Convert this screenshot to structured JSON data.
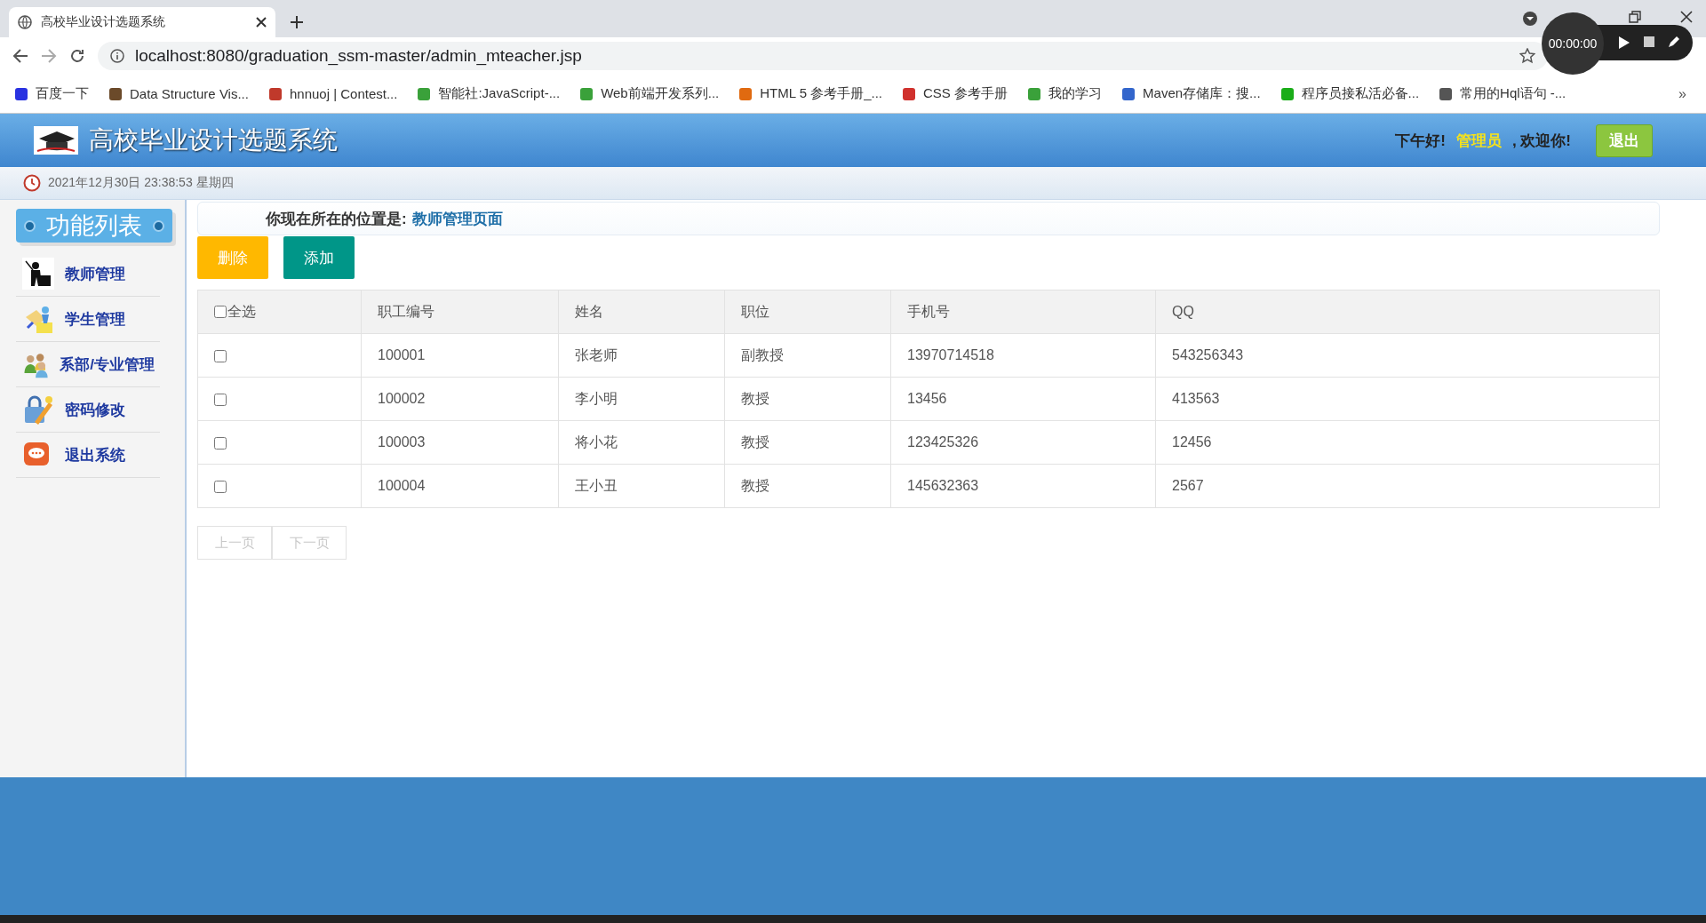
{
  "browser": {
    "tab_title": "高校毕业设计选题系统",
    "url": "localhost:8080/graduation_ssm-master/admin_mteacher.jsp",
    "more": "»",
    "bookmarks": [
      {
        "label": "百度一下",
        "color": "#2932e1"
      },
      {
        "label": "Data Structure Vis...",
        "color": "#6b4a2a"
      },
      {
        "label": "hnnuoj | Contest...",
        "color": "#c0392b"
      },
      {
        "label": "智能社:JavaScript-...",
        "color": "#3aa13a"
      },
      {
        "label": "Web前端开发系列...",
        "color": "#3aa13a"
      },
      {
        "label": "HTML 5 参考手册_...",
        "color": "#e06a10"
      },
      {
        "label": "CSS 参考手册",
        "color": "#d0312d"
      },
      {
        "label": "我的学习",
        "color": "#3aa13a"
      },
      {
        "label": "Maven存储库：搜...",
        "color": "#3366cc"
      },
      {
        "label": "程序员接私活必备...",
        "color": "#1aad19"
      },
      {
        "label": "常用的Hql语句 -...",
        "color": "#555555"
      }
    ]
  },
  "recorder": {
    "time": "00:00:00"
  },
  "header": {
    "title": "高校毕业设计选题系统",
    "greeting": "下午好!",
    "user": "管理员",
    "welcome": ", 欢迎你!",
    "logout": "退出"
  },
  "datetime": "2021年12月30日 23:38:53 星期四",
  "sidebar": {
    "title": "功能列表",
    "items": [
      {
        "label": "教师管理",
        "kind": "teacher"
      },
      {
        "label": "学生管理",
        "kind": "students"
      },
      {
        "label": "系部/专业管理",
        "kind": "people"
      },
      {
        "label": "密码修改",
        "kind": "password"
      },
      {
        "label": "退出系统",
        "kind": "exit"
      }
    ]
  },
  "breadcrumb": {
    "prefix": "你现在所在的位置是:",
    "page": "教师管理页面"
  },
  "actions": [
    {
      "label": "删除",
      "kind": "warning"
    },
    {
      "label": "添加",
      "kind": "primary"
    }
  ],
  "table": {
    "select_all": {
      "label": "全选",
      "checked": false
    },
    "columns": [
      "职工编号",
      "姓名",
      "职位",
      "手机号",
      "QQ"
    ],
    "rows": [
      {
        "checked": false,
        "cells": [
          "100001",
          "张老师",
          "副教授",
          "13970714518",
          "543256343"
        ]
      },
      {
        "checked": false,
        "cells": [
          "100002",
          "李小明",
          "教授",
          "13456",
          "413563"
        ]
      },
      {
        "checked": false,
        "cells": [
          "100003",
          "将小花",
          "教授",
          "123425326",
          "12456"
        ]
      },
      {
        "checked": false,
        "cells": [
          "100004",
          "王小丑",
          "教授",
          "145632363",
          "2567"
        ]
      }
    ]
  },
  "pagination": [
    {
      "label": "上一页",
      "disabled": true
    },
    {
      "label": "下一页",
      "disabled": true
    }
  ]
}
